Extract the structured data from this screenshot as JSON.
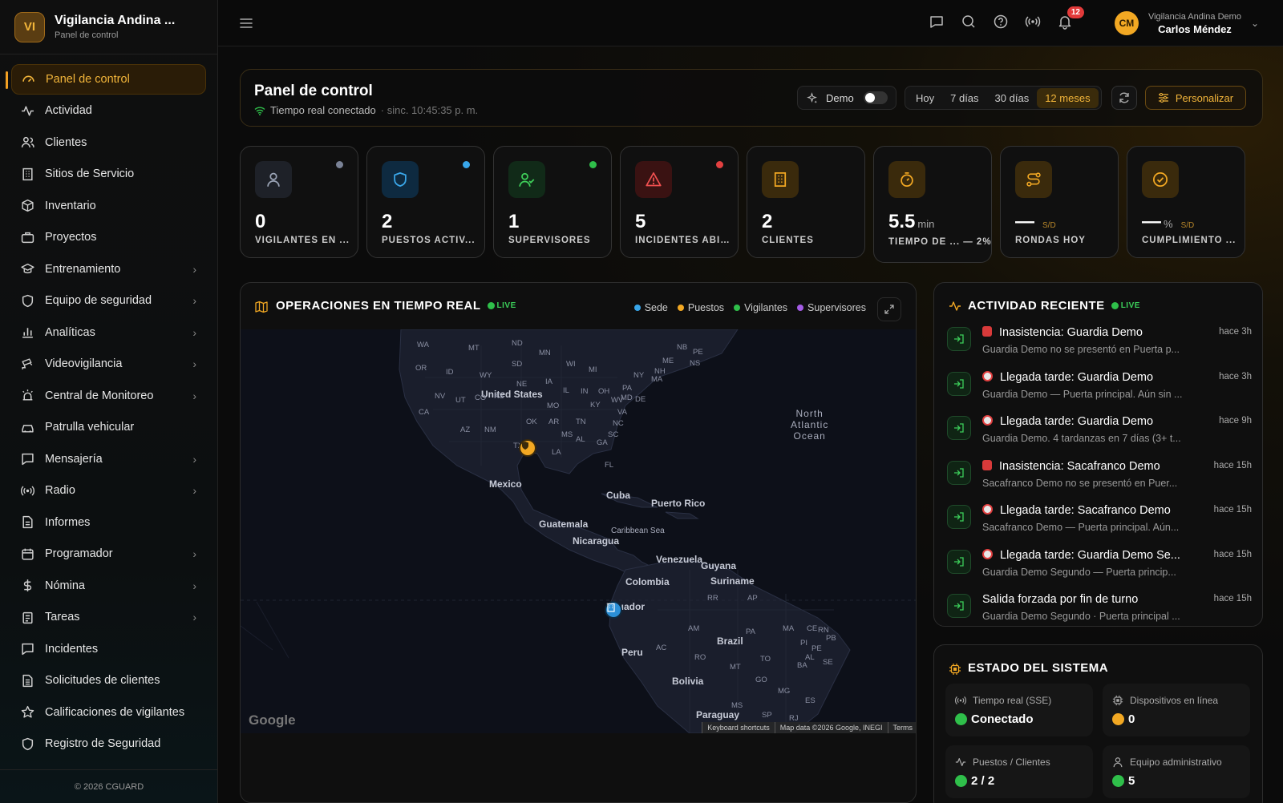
{
  "brand": {
    "initials": "VI",
    "name": "Vigilancia Andina ...",
    "subtitle": "Panel de control"
  },
  "nav": [
    {
      "label": "Panel de control",
      "icon": "gauge-icon",
      "active": true,
      "chevron": false
    },
    {
      "label": "Actividad",
      "icon": "activity-icon",
      "chevron": false
    },
    {
      "label": "Clientes",
      "icon": "users-icon",
      "chevron": false
    },
    {
      "label": "Sitios de Servicio",
      "icon": "building-icon",
      "chevron": false
    },
    {
      "label": "Inventario",
      "icon": "box-icon",
      "chevron": false
    },
    {
      "label": "Proyectos",
      "icon": "briefcase-icon",
      "chevron": false
    },
    {
      "label": "Entrenamiento",
      "icon": "graduation-icon",
      "chevron": true
    },
    {
      "label": "Equipo de seguridad",
      "icon": "shield-icon",
      "chevron": true
    },
    {
      "label": "Analíticas",
      "icon": "bar-chart-icon",
      "chevron": true
    },
    {
      "label": "Videovigilancia",
      "icon": "cctv-icon",
      "chevron": true
    },
    {
      "label": "Central de Monitoreo",
      "icon": "siren-icon",
      "chevron": true
    },
    {
      "label": "Patrulla vehicular",
      "icon": "car-icon",
      "chevron": false
    },
    {
      "label": "Mensajería",
      "icon": "message-icon",
      "chevron": true
    },
    {
      "label": "Radio",
      "icon": "radio-icon",
      "chevron": true
    },
    {
      "label": "Informes",
      "icon": "file-icon",
      "chevron": false
    },
    {
      "label": "Programador",
      "icon": "calendar-icon",
      "chevron": true
    },
    {
      "label": "Nómina",
      "icon": "dollar-icon",
      "chevron": true
    },
    {
      "label": "Tareas",
      "icon": "clipboard-icon",
      "chevron": true
    },
    {
      "label": "Incidentes",
      "icon": "message-square-icon",
      "chevron": false
    },
    {
      "label": "Solicitudes de clientes",
      "icon": "file-text-icon",
      "chevron": false
    },
    {
      "label": "Calificaciones de vigilantes",
      "icon": "star-icon",
      "chevron": false
    },
    {
      "label": "Registro de Seguridad",
      "icon": "shield-icon",
      "chevron": false
    }
  ],
  "footer": "© 2026 CGUARD",
  "topbar": {
    "icons": [
      "message-icon",
      "search-icon",
      "help-icon",
      "broadcast-icon",
      "bell-icon"
    ],
    "notifications": "12",
    "user": {
      "initials": "CM",
      "org": "Vigilancia Andina Demo",
      "name": "Carlos Méndez"
    }
  },
  "header": {
    "title": "Panel de control",
    "realtime": "Tiempo real conectado",
    "sync": "· sinc. 10:45:35 p. m.",
    "demo_label": "Demo",
    "demo_on": false,
    "ranges": [
      "Hoy",
      "7 días",
      "30 días",
      "12 meses"
    ],
    "selected_range": "12 meses",
    "customize": "Personalizar"
  },
  "kpis": [
    {
      "value": "0",
      "label": "VIGILANTES EN ...",
      "dot": "#7a8296",
      "icon_bg": "#1e2128",
      "icon_color": "#9aa3b5",
      "icon": "user-icon"
    },
    {
      "value": "2",
      "label": "PUESTOS ACTIV...",
      "dot": "#38a6ea",
      "icon_bg": "#0e2a40",
      "icon_color": "#3aa6e8",
      "icon": "shield-icon"
    },
    {
      "value": "1",
      "label": "SUPERVISORES",
      "dot": "#2fbf4a",
      "icon_bg": "#112a18",
      "icon_color": "#3fcf5a",
      "icon": "user-check-icon"
    },
    {
      "value": "5",
      "label": "INCIDENTES ABI...",
      "dot": "#e24040",
      "icon_bg": "#3a1212",
      "icon_color": "#f05050",
      "icon": "alert-icon"
    },
    {
      "value": "2",
      "label": "CLIENTES",
      "dot": null,
      "icon_bg": "#3a2a0c",
      "icon_color": "#f2a823",
      "icon": "building-icon"
    },
    {
      "value": "5.5",
      "unit": "min",
      "label": "TIEMPO DE ... — 2%",
      "dot": null,
      "icon_bg": "#3a2a0c",
      "icon_color": "#f2a823",
      "icon": "timer-icon"
    },
    {
      "value": "—",
      "unit_sd": "S/D",
      "label": "RONDAS HOY",
      "dot": null,
      "icon_bg": "#3a2a0c",
      "icon_color": "#f2a823",
      "icon": "route-icon"
    },
    {
      "value": "—",
      "unit": "%",
      "unit_sd": "S/D",
      "label": "CUMPLIMIENTO ...",
      "dot": null,
      "icon_bg": "#3a2a0c",
      "icon_color": "#f2a823",
      "icon": "check-circle-icon"
    }
  ],
  "map_card": {
    "title": "OPERACIONES EN TIEMPO REAL",
    "live": "LIVE",
    "legend": [
      {
        "label": "Sede",
        "color": "#38a6ea"
      },
      {
        "label": "Puestos",
        "color": "#f2a823"
      },
      {
        "label": "Vigilantes",
        "color": "#2fbf4a"
      },
      {
        "label": "Supervisores",
        "color": "#a45ce6"
      }
    ],
    "labels": {
      "us": "United States",
      "mexico": "Mexico",
      "cuba": "Cuba",
      "pr": "Puerto Rico",
      "guatemala": "Guatemala",
      "caribbean": "Caribbean Sea",
      "nicaragua": "Nicaragua",
      "venezuela": "Venezuela",
      "guyana": "Guyana",
      "suriname": "Suriname",
      "colombia": "Colombia",
      "ecuador": "Ecuador",
      "peru": "Peru",
      "brazil": "Brazil",
      "bolivia": "Bolivia",
      "paraguay": "Paraguay",
      "ocean": "North\nAtlantic\nOcean"
    },
    "states": [
      "WA",
      "MT",
      "ND",
      "MN",
      "NB",
      "PE",
      "OR",
      "ID",
      "SD",
      "WI",
      "MI",
      "ME",
      "NS",
      "WY",
      "NH",
      "NE",
      "NY",
      "MA",
      "NV",
      "UT",
      "IA",
      "IL",
      "IN",
      "OH",
      "PA",
      "CA",
      "CO",
      "KS",
      "MO",
      "KY",
      "WV",
      "MD",
      "DE",
      "VA",
      "AZ",
      "NM",
      "OK",
      "AR",
      "TN",
      "NC",
      "MS",
      "AL",
      "SC",
      "GA",
      "TX",
      "LA",
      "FL",
      "RR",
      "AP",
      "AM",
      "PA",
      "MA",
      "CE",
      "RN",
      "PB",
      "PI",
      "PE",
      "AC",
      "RO",
      "AL",
      "TO",
      "SE",
      "BA",
      "MT",
      "GO",
      "MG",
      "ES",
      "MS",
      "SP",
      "RJ"
    ],
    "attribution": [
      "Keyboard shortcuts",
      "Map data ©2026 Google, INEGI",
      "Terms"
    ],
    "google": "Google"
  },
  "activity": {
    "title": "ACTIVIDAD RECIENTE",
    "live": "LIVE",
    "items": [
      {
        "kind": "red",
        "title": "Inasistencia: Guardia Demo",
        "desc": "Guardia Demo no se presentó en Puerta p...",
        "time": "hace 3h"
      },
      {
        "kind": "clock",
        "title": "Llegada tarde: Guardia Demo",
        "desc": "Guardia Demo — Puerta principal. Aún sin ...",
        "time": "hace 3h"
      },
      {
        "kind": "clock",
        "title": "Llegada tarde: Guardia Demo",
        "desc": "Guardia Demo. 4 tardanzas en 7 días (3+ t...",
        "time": "hace 9h"
      },
      {
        "kind": "red",
        "title": "Inasistencia: Sacafranco Demo",
        "desc": "Sacafranco Demo no se presentó en Puer...",
        "time": "hace 15h"
      },
      {
        "kind": "clock",
        "title": "Llegada tarde: Sacafranco Demo",
        "desc": "Sacafranco Demo — Puerta principal. Aún...",
        "time": "hace 15h"
      },
      {
        "kind": "clock",
        "title": "Llegada tarde: Guardia Demo Se...",
        "desc": "Guardia Demo Segundo — Puerta princip...",
        "time": "hace 15h"
      },
      {
        "kind": "none",
        "title": "Salida forzada por fin de turno",
        "desc": "Guardia Demo Segundo · Puerta principal ...",
        "time": "hace 15h"
      }
    ]
  },
  "system": {
    "title": "ESTADO DEL SISTEMA",
    "boxes": [
      {
        "label": "Tiempo real (SSE)",
        "value": "Conectado",
        "status": "#2fbf4a",
        "icon": "broadcast-icon"
      },
      {
        "label": "Dispositivos en línea",
        "value": "0",
        "status": "#f2a823",
        "icon": "chip-icon"
      },
      {
        "label": "Puestos / Clientes",
        "value": "2 / 2",
        "status": "#2fbf4a",
        "icon": "activity-icon"
      },
      {
        "label": "Equipo administrativo",
        "value": "5",
        "status": "#2fbf4a",
        "icon": "user-icon"
      }
    ]
  }
}
